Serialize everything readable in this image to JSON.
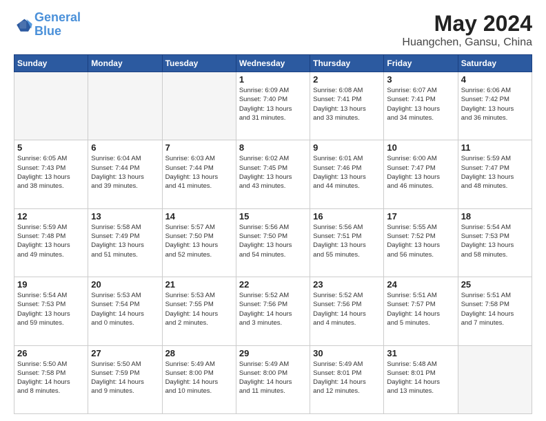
{
  "logo": {
    "line1": "General",
    "line2": "Blue"
  },
  "title": "May 2024",
  "subtitle": "Huangchen, Gansu, China",
  "days_of_week": [
    "Sunday",
    "Monday",
    "Tuesday",
    "Wednesday",
    "Thursday",
    "Friday",
    "Saturday"
  ],
  "weeks": [
    [
      {
        "day": "",
        "info": ""
      },
      {
        "day": "",
        "info": ""
      },
      {
        "day": "",
        "info": ""
      },
      {
        "day": "1",
        "info": "Sunrise: 6:09 AM\nSunset: 7:40 PM\nDaylight: 13 hours\nand 31 minutes."
      },
      {
        "day": "2",
        "info": "Sunrise: 6:08 AM\nSunset: 7:41 PM\nDaylight: 13 hours\nand 33 minutes."
      },
      {
        "day": "3",
        "info": "Sunrise: 6:07 AM\nSunset: 7:41 PM\nDaylight: 13 hours\nand 34 minutes."
      },
      {
        "day": "4",
        "info": "Sunrise: 6:06 AM\nSunset: 7:42 PM\nDaylight: 13 hours\nand 36 minutes."
      }
    ],
    [
      {
        "day": "5",
        "info": "Sunrise: 6:05 AM\nSunset: 7:43 PM\nDaylight: 13 hours\nand 38 minutes."
      },
      {
        "day": "6",
        "info": "Sunrise: 6:04 AM\nSunset: 7:44 PM\nDaylight: 13 hours\nand 39 minutes."
      },
      {
        "day": "7",
        "info": "Sunrise: 6:03 AM\nSunset: 7:44 PM\nDaylight: 13 hours\nand 41 minutes."
      },
      {
        "day": "8",
        "info": "Sunrise: 6:02 AM\nSunset: 7:45 PM\nDaylight: 13 hours\nand 43 minutes."
      },
      {
        "day": "9",
        "info": "Sunrise: 6:01 AM\nSunset: 7:46 PM\nDaylight: 13 hours\nand 44 minutes."
      },
      {
        "day": "10",
        "info": "Sunrise: 6:00 AM\nSunset: 7:47 PM\nDaylight: 13 hours\nand 46 minutes."
      },
      {
        "day": "11",
        "info": "Sunrise: 5:59 AM\nSunset: 7:47 PM\nDaylight: 13 hours\nand 48 minutes."
      }
    ],
    [
      {
        "day": "12",
        "info": "Sunrise: 5:59 AM\nSunset: 7:48 PM\nDaylight: 13 hours\nand 49 minutes."
      },
      {
        "day": "13",
        "info": "Sunrise: 5:58 AM\nSunset: 7:49 PM\nDaylight: 13 hours\nand 51 minutes."
      },
      {
        "day": "14",
        "info": "Sunrise: 5:57 AM\nSunset: 7:50 PM\nDaylight: 13 hours\nand 52 minutes."
      },
      {
        "day": "15",
        "info": "Sunrise: 5:56 AM\nSunset: 7:50 PM\nDaylight: 13 hours\nand 54 minutes."
      },
      {
        "day": "16",
        "info": "Sunrise: 5:56 AM\nSunset: 7:51 PM\nDaylight: 13 hours\nand 55 minutes."
      },
      {
        "day": "17",
        "info": "Sunrise: 5:55 AM\nSunset: 7:52 PM\nDaylight: 13 hours\nand 56 minutes."
      },
      {
        "day": "18",
        "info": "Sunrise: 5:54 AM\nSunset: 7:53 PM\nDaylight: 13 hours\nand 58 minutes."
      }
    ],
    [
      {
        "day": "19",
        "info": "Sunrise: 5:54 AM\nSunset: 7:53 PM\nDaylight: 13 hours\nand 59 minutes."
      },
      {
        "day": "20",
        "info": "Sunrise: 5:53 AM\nSunset: 7:54 PM\nDaylight: 14 hours\nand 0 minutes."
      },
      {
        "day": "21",
        "info": "Sunrise: 5:53 AM\nSunset: 7:55 PM\nDaylight: 14 hours\nand 2 minutes."
      },
      {
        "day": "22",
        "info": "Sunrise: 5:52 AM\nSunset: 7:56 PM\nDaylight: 14 hours\nand 3 minutes."
      },
      {
        "day": "23",
        "info": "Sunrise: 5:52 AM\nSunset: 7:56 PM\nDaylight: 14 hours\nand 4 minutes."
      },
      {
        "day": "24",
        "info": "Sunrise: 5:51 AM\nSunset: 7:57 PM\nDaylight: 14 hours\nand 5 minutes."
      },
      {
        "day": "25",
        "info": "Sunrise: 5:51 AM\nSunset: 7:58 PM\nDaylight: 14 hours\nand 7 minutes."
      }
    ],
    [
      {
        "day": "26",
        "info": "Sunrise: 5:50 AM\nSunset: 7:58 PM\nDaylight: 14 hours\nand 8 minutes."
      },
      {
        "day": "27",
        "info": "Sunrise: 5:50 AM\nSunset: 7:59 PM\nDaylight: 14 hours\nand 9 minutes."
      },
      {
        "day": "28",
        "info": "Sunrise: 5:49 AM\nSunset: 8:00 PM\nDaylight: 14 hours\nand 10 minutes."
      },
      {
        "day": "29",
        "info": "Sunrise: 5:49 AM\nSunset: 8:00 PM\nDaylight: 14 hours\nand 11 minutes."
      },
      {
        "day": "30",
        "info": "Sunrise: 5:49 AM\nSunset: 8:01 PM\nDaylight: 14 hours\nand 12 minutes."
      },
      {
        "day": "31",
        "info": "Sunrise: 5:48 AM\nSunset: 8:01 PM\nDaylight: 14 hours\nand 13 minutes."
      },
      {
        "day": "",
        "info": ""
      }
    ]
  ]
}
